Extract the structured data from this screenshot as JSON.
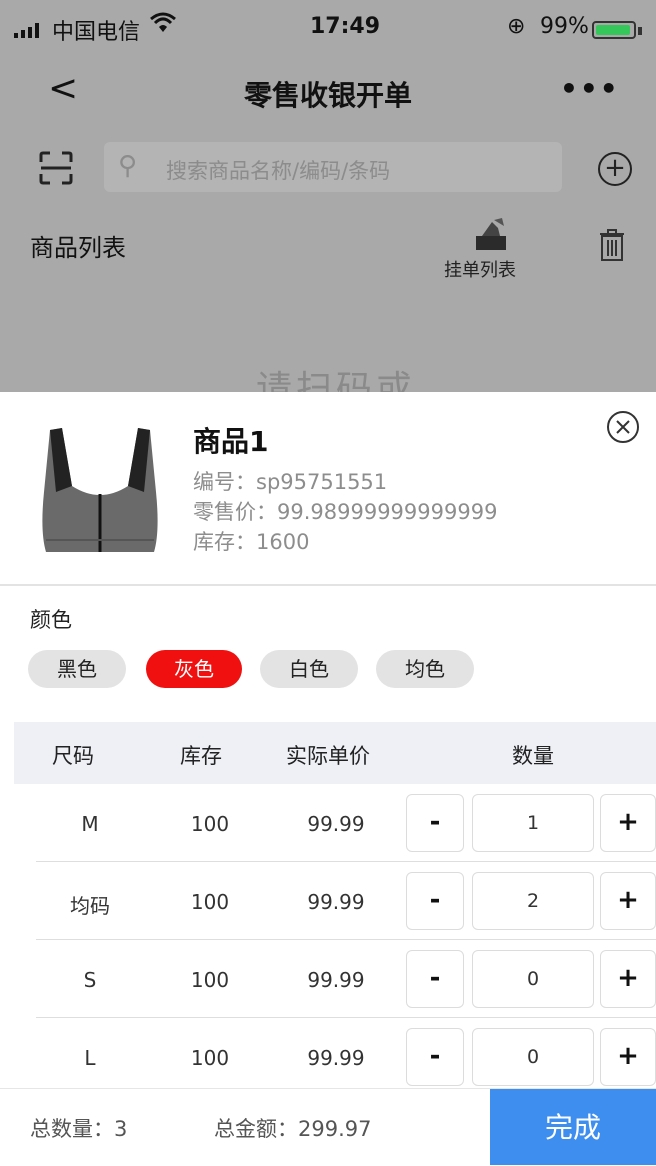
{
  "status_bar": {
    "carrier": "中国电信",
    "time": "17:49",
    "battery": "99%",
    "battery_level": 0.99
  },
  "nav": {
    "back": "<",
    "title": "零售收银开单",
    "more": "•••"
  },
  "search": {
    "placeholder": "搜索商品名称/编码/条码"
  },
  "list_header": {
    "title": "商品列表",
    "hang_list_label": "挂单列表"
  },
  "behind_hint": "请扫码或",
  "product": {
    "name": "商品1",
    "code": "编号：sp95751551",
    "price": "零售价：99.98999999999999",
    "stock": "库存：1600"
  },
  "color": {
    "label": "颜色",
    "options": [
      {
        "label": "黑色",
        "selected": false
      },
      {
        "label": "灰色",
        "selected": true
      },
      {
        "label": "白色",
        "selected": false
      },
      {
        "label": "均色",
        "selected": false
      }
    ],
    "active_color": "#f0100f"
  },
  "table": {
    "headers": [
      "尺码",
      "库存",
      "实际单价",
      "数量"
    ],
    "rows": [
      {
        "size": "M",
        "stock": "100",
        "price": "99.99",
        "qty": "1"
      },
      {
        "size": "均码",
        "stock": "100",
        "price": "99.99",
        "qty": "2"
      },
      {
        "size": "S",
        "stock": "100",
        "price": "99.99",
        "qty": "0"
      },
      {
        "size": "L",
        "stock": "100",
        "price": "99.99",
        "qty": "0"
      }
    ],
    "minus": "-",
    "plus": "+"
  },
  "footer": {
    "total_qty": "总数量：3",
    "total_amount": "总金额：299.97",
    "done": "完成",
    "done_color": "#3e8ef0"
  }
}
